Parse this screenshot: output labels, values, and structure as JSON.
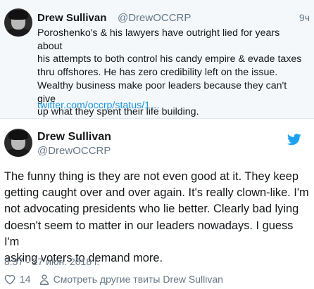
{
  "reply_context": {
    "author_name": "Drew Sullivan",
    "author_handle": "@DrewOCCRP",
    "time_ago": "9ч",
    "text": "Poroshenko's & his lawyers have outright lied for years about\nhis attempts to both control his candy empire & evade taxes\nthru offshores. He has zero credibility left on the issue.\nWealthy business make poor leaders because they can't give\nup what they spent their life building.",
    "link": "twitter.com/occrp/status/1…"
  },
  "tweet": {
    "author_name": "Drew Sullivan",
    "author_handle": "@DrewOCCRP",
    "text": "The funny thing is they are not even good at it. They keep\ngetting caught over and over again. It's really clown-like. I'm\nnot advocating presidents who lie better. Clearly bad lying\ndoesn't seem to matter in our leaders nowadays. I guess I'm\nasking voters to demand more.",
    "timestamp": "8:37 - 27 июн. 2018 г.",
    "likes": "14",
    "more_tweets_label": "Смотреть другие твиты Drew Sullivan"
  },
  "icons": {
    "brand": "twitter-bird-icon",
    "like": "heart-icon",
    "profile": "person-icon"
  },
  "colors": {
    "link": "#1b95e0",
    "muted": "#657786",
    "text": "#14171a",
    "quoted_bg": "#f5f8fa"
  }
}
